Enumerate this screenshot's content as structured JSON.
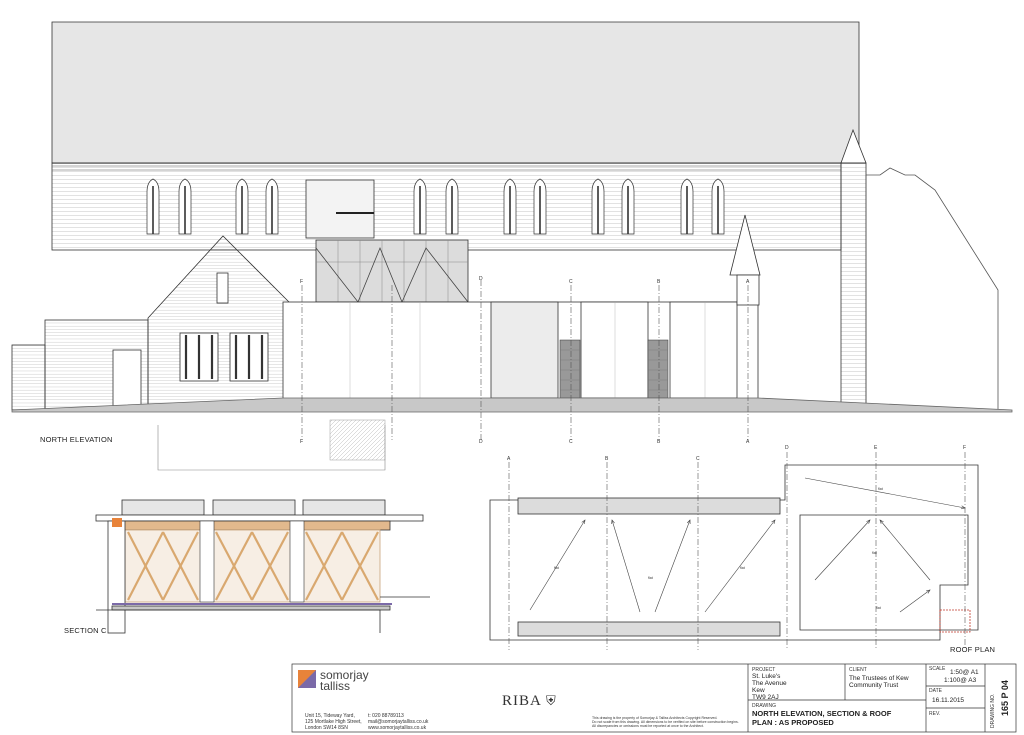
{
  "labels": {
    "north_elevation": "NORTH  ELEVATION",
    "section_c": "SECTION  C",
    "roof_plan": "ROOF  PLAN"
  },
  "section_markers": [
    "A",
    "B",
    "C",
    "D",
    "E",
    "F"
  ],
  "roof_notes": {
    "flat": "flat"
  },
  "title_block": {
    "firm": {
      "line1": "somorjay",
      "line2": "talliss"
    },
    "address": [
      "Unit 15, Tideway Yard,",
      "125 Mortlake High Street,",
      "London SW14 8SN"
    ],
    "contact": [
      "t: 020 88789113",
      "mail@somorjaytalliss.co.uk",
      "www.somorjaytalliss.co.uk"
    ],
    "riba": "RIBA",
    "copyright": [
      "This drawing is the property of Somorjay & Talliss Architects Copyright Reserved.",
      "Do not scale from this drawing. All dimensions to be verified on site before construction begins.",
      "All discrepancies or omissions must be reported at once to the Architect."
    ],
    "project_label": "PROJECT",
    "project": [
      "St. Luke's",
      "The Avenue",
      "Kew",
      "TW9 2AJ"
    ],
    "client_label": "CLIENT",
    "client": [
      "The Trustees of Kew",
      "Community Trust"
    ],
    "scale_label": "SCALE",
    "scale": [
      "1:50@ A1",
      "1:100@ A3"
    ],
    "date_label": "DATE",
    "date": "16.11.2015",
    "drawing_label": "DRAWING",
    "drawing": [
      "NORTH  ELEVATION,  SECTION & ROOF",
      "PLAN :  AS  PROPOSED"
    ],
    "rev_label": "REV.",
    "drawing_no_label": "DRAWING NO.",
    "drawing_no": "165 P 04"
  },
  "colors": {
    "line": "#333333",
    "ground": "#c8c8c8",
    "roof": "#e6e6e6",
    "glazing": "#dcdcdc",
    "timber": "#e2b98d",
    "accent_red": "#c0392b",
    "logo_orange": "#e8833a",
    "logo_purple": "#7b6aa8"
  }
}
